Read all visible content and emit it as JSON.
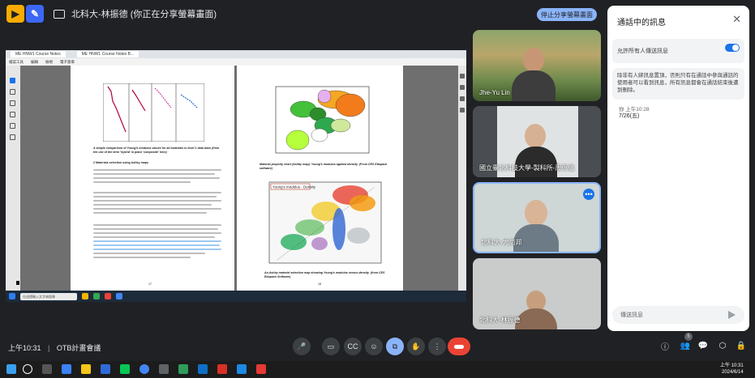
{
  "meet": {
    "share_title": "北科大-林振德 (你正在分享螢幕畫面)",
    "stop_share_label": "停止分享螢幕畫面",
    "clock": "上午10:31",
    "meeting_name": "OTB計畫會議",
    "people_count": "5"
  },
  "presentation": {
    "tabs": [
      "ME HNW1 Course Notes",
      "ME HNW1 Course Notes B..."
    ],
    "menu": [
      "檔案工具",
      "編輯",
      "檢視",
      "電子簽章"
    ],
    "search_placeholder": "在這裡輸入文字來搜尋",
    "page1": {
      "caption": "A simple comparison of Young's modulus values for all materials to level 1 data base (from the use of the term 'hybrid' in place 'composite' here)",
      "section": "2 Materials selection using Ashby maps",
      "page_no": "17"
    },
    "page2": {
      "chart1_caption": "Material property chart (Ashby map): Young's modulus against density. (From CES Edupack software)",
      "chart2_title": "Young's modulus - Density",
      "chart2_caption": "An Ashby material selection map showing Young's modulus versus density. (from CES Edupack Software)",
      "page_no": "18"
    }
  },
  "participants": [
    {
      "name": "Jhe-Yu Lin"
    },
    {
      "name": "國立臺北科技大學-製科所-周佩儀"
    },
    {
      "name": "北科大-尤尚邦"
    },
    {
      "name": "北科大-林振德"
    }
  ],
  "chat": {
    "title": "通話中的訊息",
    "allow_label": "允許所有人傳送訊息",
    "notice": "除非有人綁訊息置頂，否則只有在通話中參與通話的使用者可以看到訊息，所有訊息都會在通話結束後遭到刪除。",
    "message_meta": "你 上午10:28",
    "message_text": "7/26(五)",
    "input_placeholder": "傳送訊息"
  },
  "system": {
    "time": "上午 10:31",
    "date": "2024/6/14"
  },
  "colors": {
    "accent": "#8ab4f8",
    "hangup": "#ea4335",
    "toggle": "#1a73e8"
  }
}
